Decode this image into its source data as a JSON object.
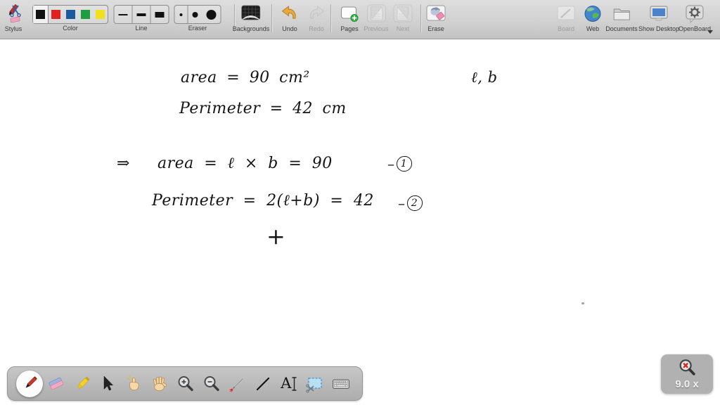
{
  "top_toolbar": {
    "stylus_label": "Stylus",
    "color_label": "Color",
    "line_label": "Line",
    "eraser_label": "Eraser",
    "backgrounds_label": "Backgrounds",
    "undo_label": "Undo",
    "redo_label": "Redo",
    "pages_label": "Pages",
    "previous_label": "Previous",
    "next_label": "Next",
    "erase_label": "Erase",
    "board_label": "Board",
    "web_label": "Web",
    "documents_label": "Documents",
    "show_desktop_label": "Show Desktop",
    "openboard_label": "OpenBoard",
    "swatches": [
      "#111111",
      "#e01f1f",
      "#1c5aa0",
      "#1e9e3e",
      "#f0e11c"
    ]
  },
  "whiteboard": {
    "line1": "area = 90 cm²",
    "line2": "Perimeter = 42 cm",
    "variables": "ℓ, b",
    "implies": "⇒",
    "eq1": "area = ℓ × b = 90",
    "dash": "–",
    "eq1_ref": "1",
    "eq2": "Perimeter = 2(ℓ+b) = 42",
    "eq2_ref": "2",
    "plus": "+"
  },
  "bottom_toolbar": {
    "text_tool_glyph": "A"
  },
  "zoom_indicator": {
    "value": "9.0 x"
  }
}
